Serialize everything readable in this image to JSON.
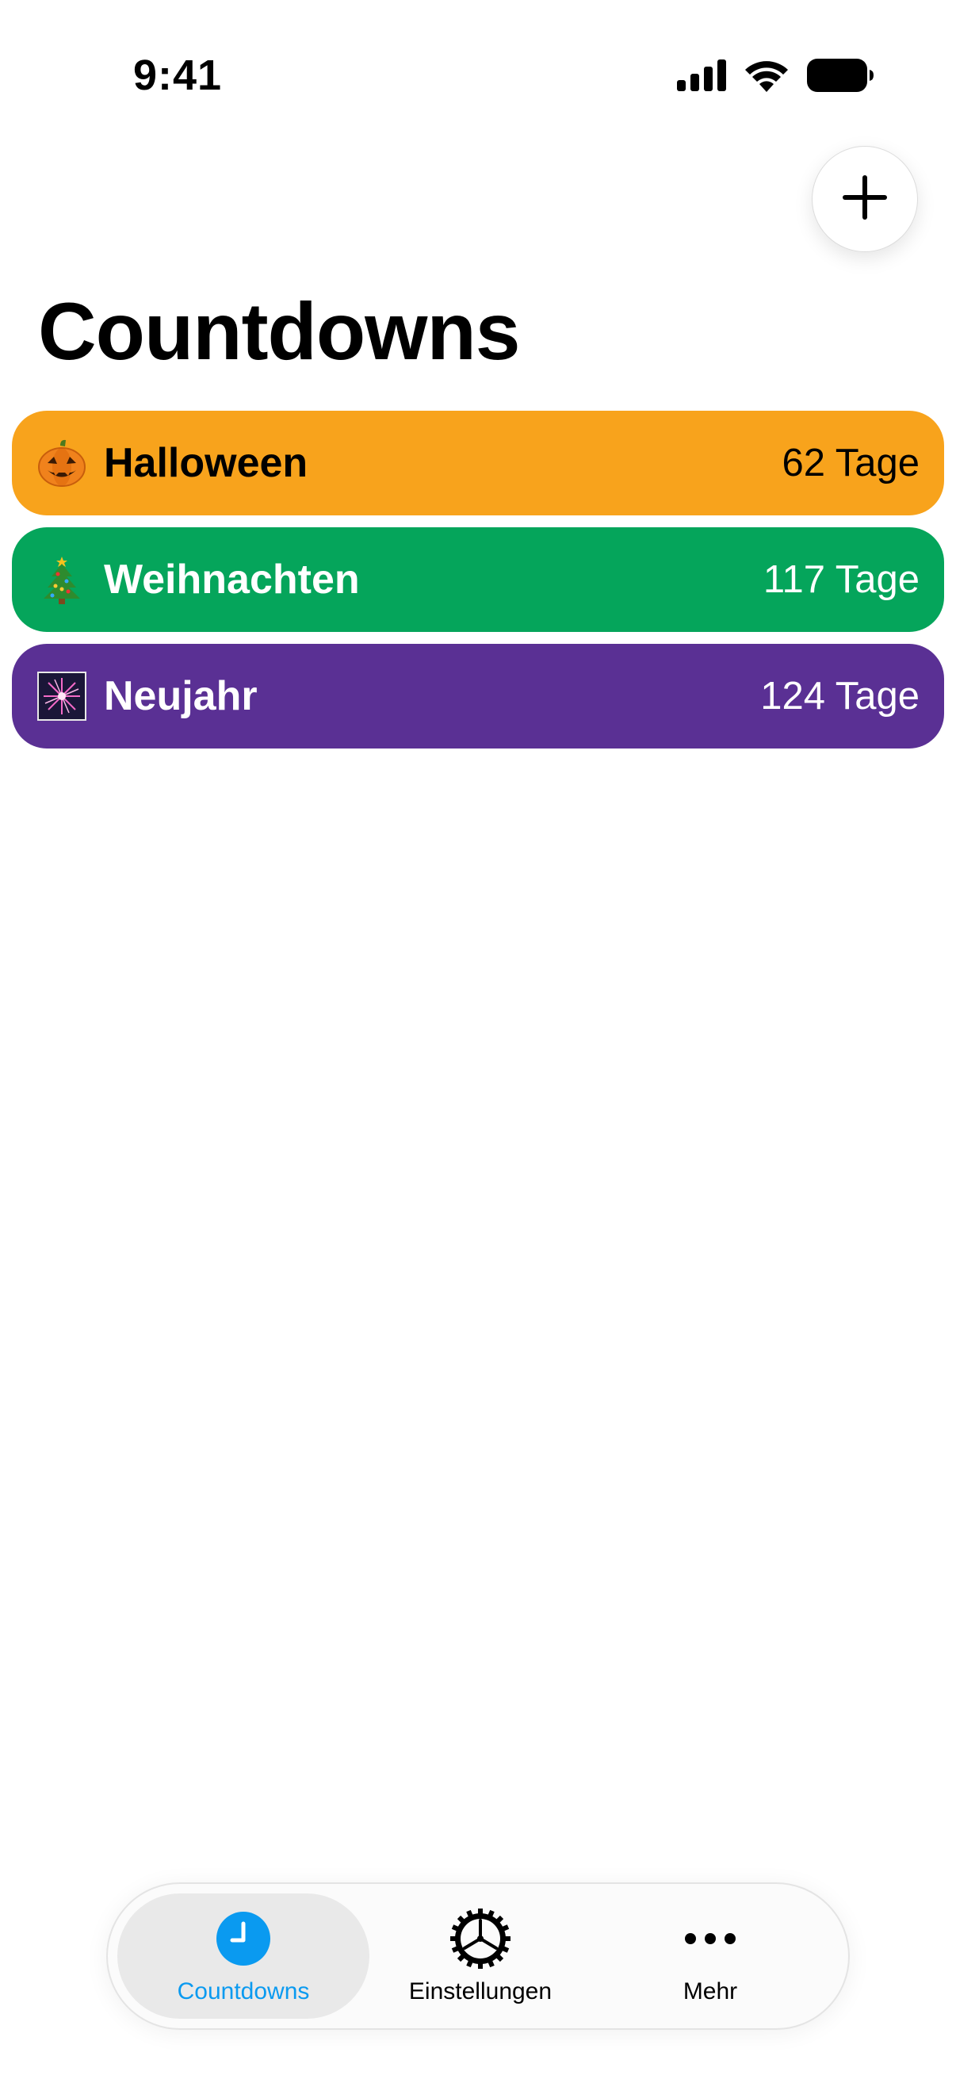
{
  "status_bar": {
    "time": "9:41"
  },
  "header": {
    "add_button_icon": "plus-icon",
    "title": "Countdowns"
  },
  "countdowns": [
    {
      "emoji": "🎃",
      "emoji_icon": "jack-o-lantern-icon",
      "name": "Halloween",
      "days": "62 Tage",
      "background": "#F8A31C",
      "text_color": "#000000"
    },
    {
      "emoji": "🎄",
      "emoji_icon": "christmas-tree-icon",
      "name": "Weihnachten",
      "days": "117 Tage",
      "background": "#05A55B",
      "text_color": "#FFFFFF"
    },
    {
      "emoji": "🎇",
      "emoji_icon": "sparkler-icon",
      "name": "Neujahr",
      "days": "124 Tage",
      "background": "#5A3094",
      "text_color": "#FFFFFF"
    }
  ],
  "tab_bar": {
    "items": [
      {
        "label": "Countdowns",
        "icon": "clock-icon",
        "active": true,
        "color": "#0A9AF0"
      },
      {
        "label": "Einstellungen",
        "icon": "gear-icon",
        "active": false,
        "color": "#000000"
      },
      {
        "label": "Mehr",
        "icon": "ellipsis-icon",
        "active": false,
        "color": "#000000"
      }
    ]
  }
}
